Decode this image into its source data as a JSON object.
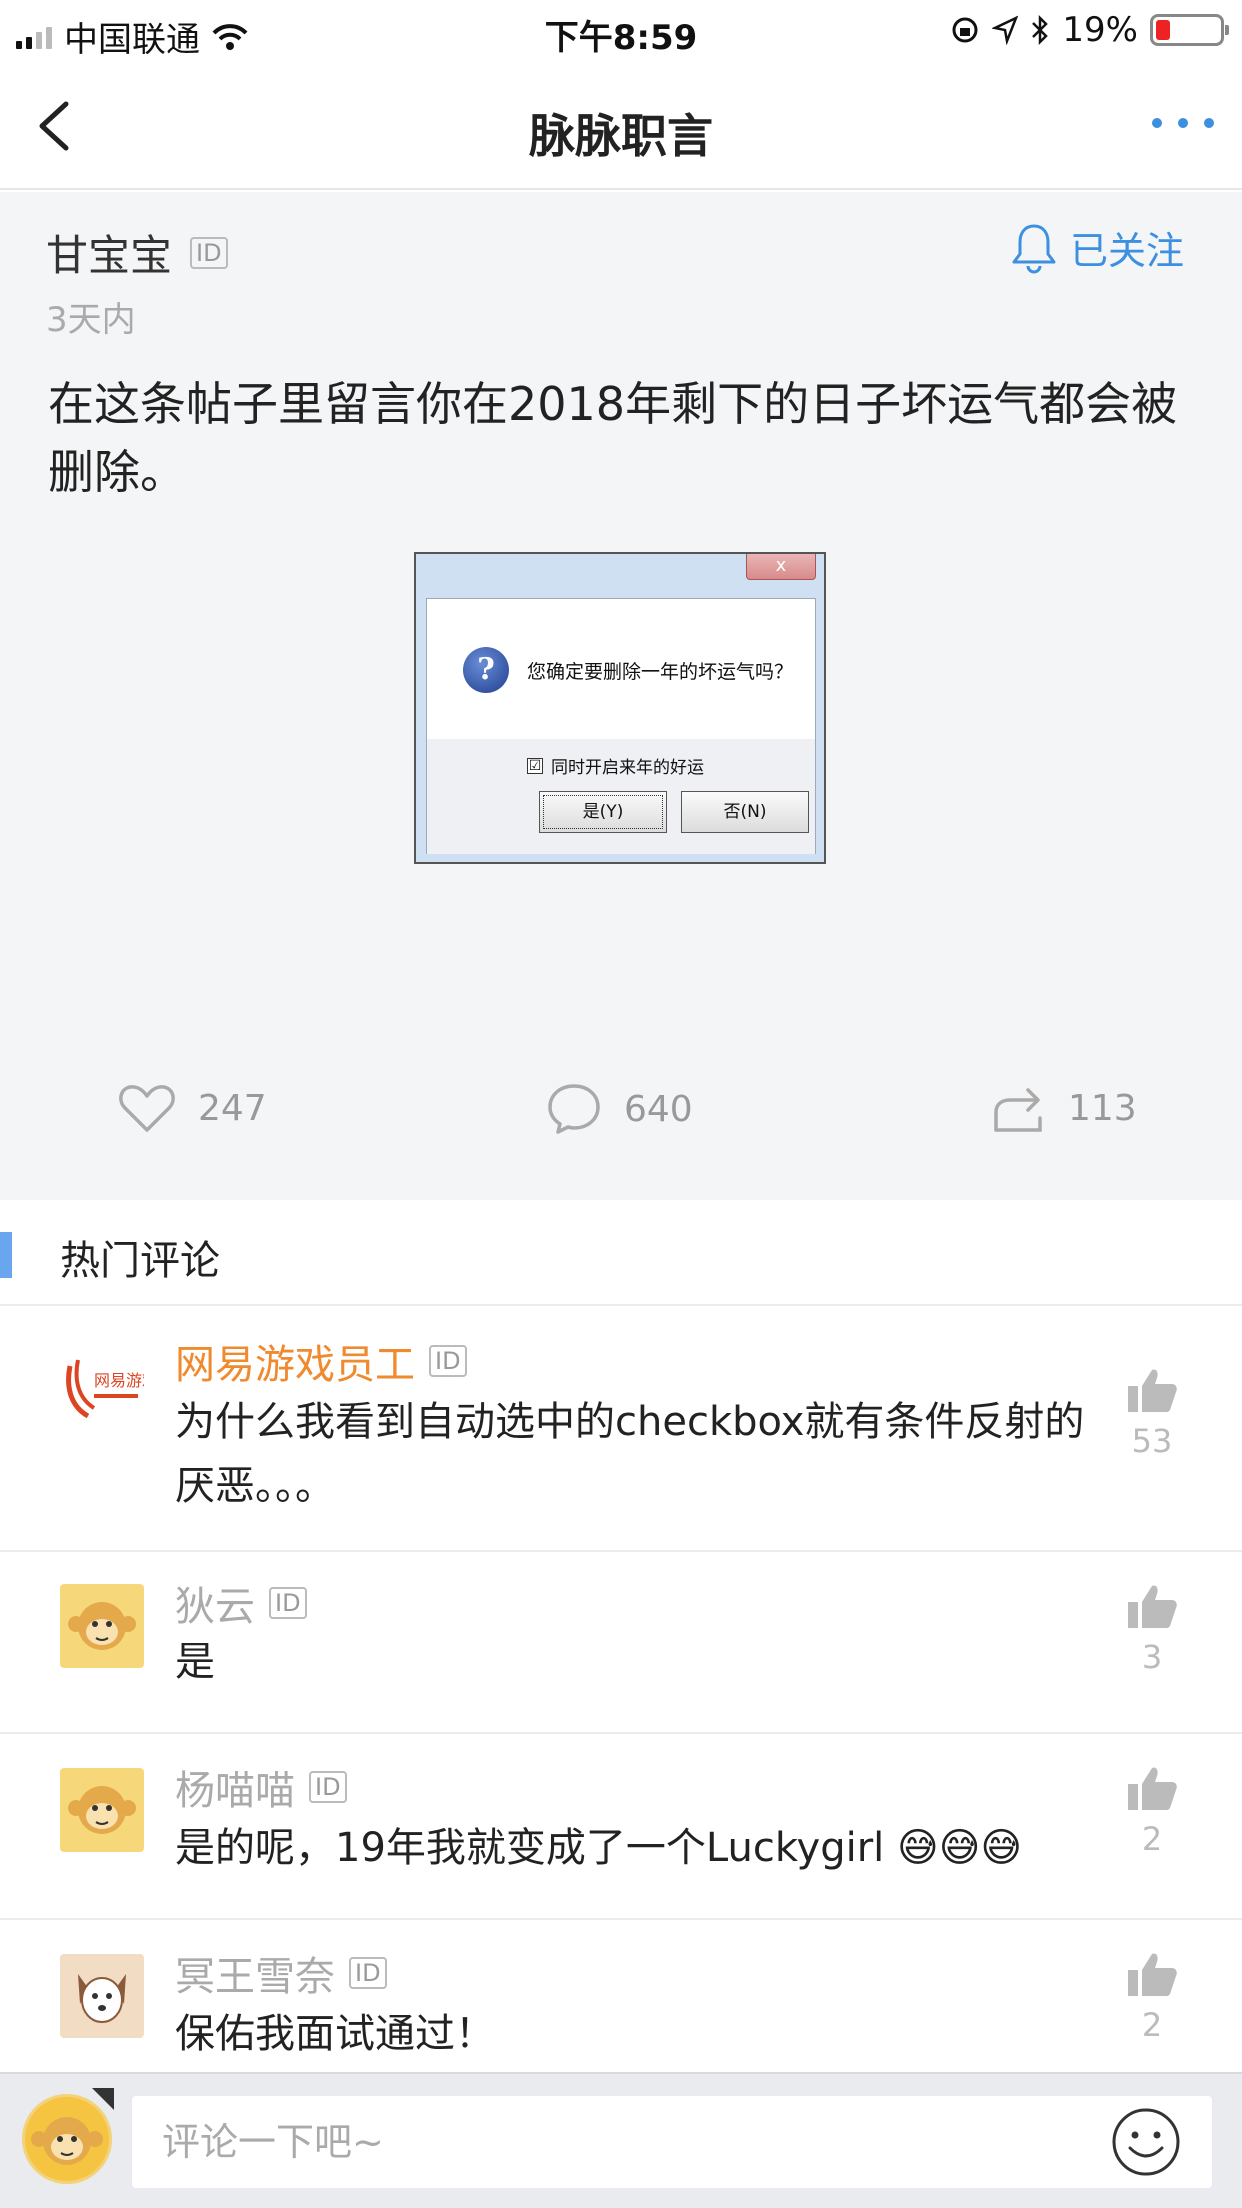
{
  "status_bar": {
    "carrier": "中国联通",
    "time": "下午8:59",
    "battery": "19%",
    "battery_color": "#e22222"
  },
  "nav": {
    "title": "脉脉职言",
    "back_icon": "chevron-left-icon",
    "more_icon": "more-dots-icon"
  },
  "post": {
    "author": "甘宝宝",
    "id_badge": "ID",
    "follow_label": "已关注",
    "time": "3天内",
    "text": "在这条帖子里留言你在2018年剩下的日子坏运气都会被删除。",
    "image": {
      "close_label": "x",
      "question_mark": "?",
      "message": "您确定要删除一年的坏运气吗？",
      "checkbox_mark": "☑",
      "checkbox_label": "同时开启来年的好运",
      "yes_label": "是(Y)",
      "no_label": "否(N)"
    },
    "likes": "247",
    "comments": "640",
    "shares": "113"
  },
  "hot_comments": {
    "title": "热门评论",
    "items": [
      {
        "name": "网易游戏员工",
        "id_badge": "ID",
        "text": "为什么我看到自动选中的checkbox就有条件反射的厌恶。。。",
        "likes": "53",
        "name_color": "#ef8a2e",
        "avatar_logo_text": "网易游戏"
      },
      {
        "name": "狄云",
        "id_badge": "ID",
        "text": "是",
        "likes": "3"
      },
      {
        "name": "杨喵喵",
        "id_badge": "ID",
        "text": "是的呢，19年我就变成了一个Luckygirl 😅😅😅",
        "likes": "2"
      },
      {
        "name": "冥王雪奈",
        "id_badge": "ID",
        "text": "保佑我面试通过！",
        "likes": "2"
      }
    ]
  },
  "bottom_bar": {
    "placeholder": "评论一下吧~",
    "emoji_icon": "smiley-icon"
  },
  "colors": {
    "accent": "#3d8fe0",
    "hot_bar": "#6aa6ee",
    "post_bg": "#f4f5f7"
  }
}
